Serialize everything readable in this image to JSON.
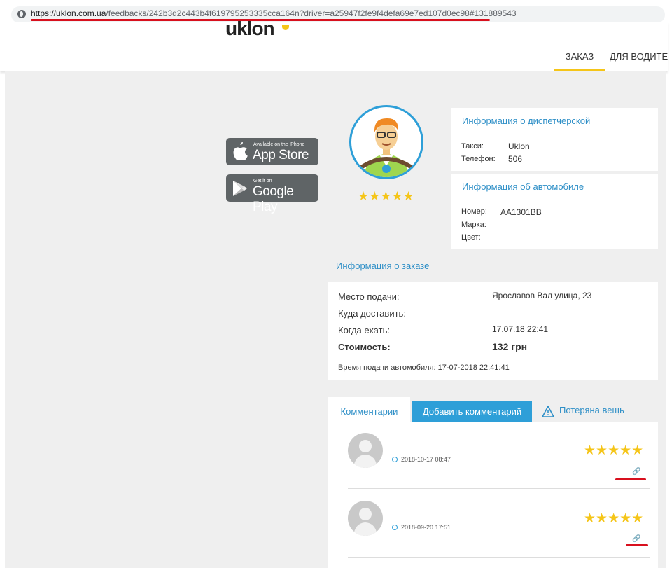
{
  "browser": {
    "url_host": "https://uklon.com.ua",
    "url_path": "/feedbacks/242b3d2c443b4f619795253335cca164n?driver=a25947f2fe9f4defa69e7ed107d0ec98#131889543"
  },
  "header": {
    "logo": "uklon",
    "nav": [
      "ЗАКАЗ",
      "ДЛЯ ВОДИТЕЛ"
    ]
  },
  "stores": {
    "appstore": {
      "small": "Available on the iPhone",
      "big": "App Store"
    },
    "googleplay": {
      "small": "Get it on",
      "big": "Google Play"
    }
  },
  "driver": {
    "rating_stars": "★★★★★",
    "rating": 5
  },
  "dispatch": {
    "title": "Информация о диспетчерской",
    "taxi_label": "Такси:",
    "taxi_value": "Uklon",
    "phone_label": "Телефон:",
    "phone_value": "506"
  },
  "car": {
    "title": "Информация об автомобиле",
    "number_label": "Номер:",
    "number_value": "AA1301BB",
    "brand_label": "Марка:",
    "color_label": "Цвет:"
  },
  "order": {
    "title": "Информация о заказе",
    "pickup_label": "Место подачи:",
    "pickup_value": "Ярославов Вал улица, 23",
    "dest_label": "Куда доставить:",
    "when_label": "Когда ехать:",
    "when_value": "17.07.18 22:41",
    "cost_label": "Стоимость:",
    "cost_value": "132 грн",
    "arrival": "Время подачи автомобиля: 17-07-2018 22:41:41"
  },
  "tabs": {
    "comments": "Комментарии",
    "add": "Добавить комментарий",
    "lost": "Потеряна вещь"
  },
  "comments": [
    {
      "date": "2018-10-17 08:47",
      "stars": "★★★★★",
      "rating": 5
    },
    {
      "date": "2018-09-20 17:51",
      "stars": "★★★★★",
      "rating": 5
    }
  ],
  "colors": {
    "accent": "#2e9fd8",
    "brand": "#f5c518",
    "highlight": "#d8101e"
  },
  "icons": [
    "globe-icon",
    "apple-icon",
    "google-play-icon",
    "warning-icon",
    "clock-icon",
    "link-icon"
  ]
}
